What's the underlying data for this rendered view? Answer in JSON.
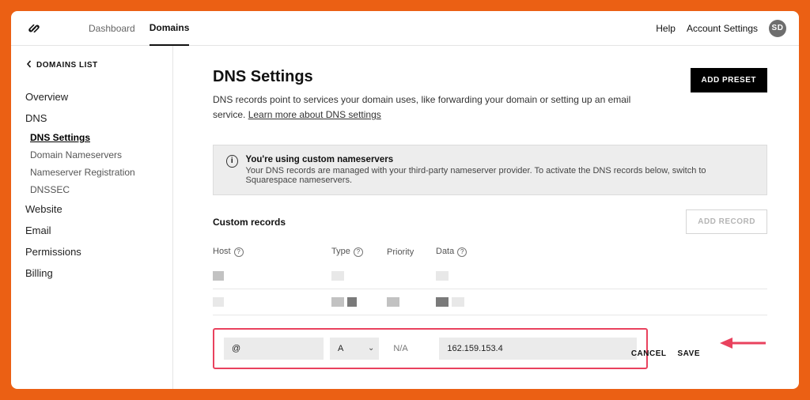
{
  "colors": {
    "accent": "#eb6014",
    "annot": "#e9425e"
  },
  "topbar": {
    "tabs": [
      "Dashboard",
      "Domains"
    ],
    "active_tab": "Domains",
    "help": "Help",
    "account": "Account Settings",
    "avatar": "SD"
  },
  "sidebar": {
    "back": "DOMAINS LIST",
    "items": [
      {
        "label": "Overview"
      },
      {
        "label": "DNS",
        "children": [
          {
            "label": "DNS Settings",
            "active": true
          },
          {
            "label": "Domain Nameservers"
          },
          {
            "label": "Nameserver Registration"
          },
          {
            "label": "DNSSEC"
          }
        ]
      },
      {
        "label": "Website"
      },
      {
        "label": "Email"
      },
      {
        "label": "Permissions"
      },
      {
        "label": "Billing"
      }
    ]
  },
  "page": {
    "title": "DNS Settings",
    "desc": "DNS records point to services your domain uses, like forwarding your domain or setting up an email service. ",
    "learn": "Learn more about DNS settings",
    "add_preset": "ADD PRESET"
  },
  "notice": {
    "title": "You're using custom nameservers",
    "body": "Your DNS records are managed with your third-party nameserver provider. To activate the DNS records below, switch to Squarespace nameservers."
  },
  "records": {
    "section_label": "Custom records",
    "add_record": "ADD RECORD",
    "columns": {
      "host": "Host",
      "type": "Type",
      "priority": "Priority",
      "data": "Data"
    },
    "new": {
      "host": "@",
      "type": "A",
      "priority_placeholder": "N/A",
      "data": "162.159.153.4"
    },
    "actions": {
      "cancel": "CANCEL",
      "save": "SAVE"
    }
  }
}
